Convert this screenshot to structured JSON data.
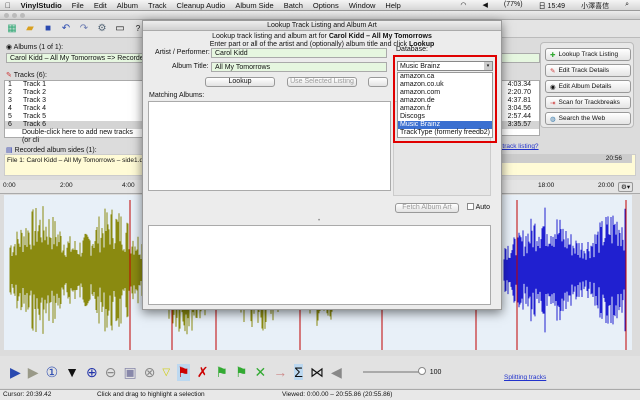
{
  "menubar": {
    "app": "VinylStudio",
    "items": [
      "File",
      "Edit",
      "Album",
      "Track",
      "Cleanup Audio",
      "Album Side",
      "Batch",
      "Options",
      "Window",
      "Help"
    ],
    "battery": "(77%)",
    "clock": "日 15:49",
    "user": "小澤喜信"
  },
  "albums": {
    "label": "Albums (1 of 1):",
    "value": "Carol Kidd – All My Tomorrows => Recorded"
  },
  "tracks": {
    "label": "Tracks (6):",
    "rows": [
      {
        "n": "1",
        "name": "Track 1",
        "time": "4:03.34"
      },
      {
        "n": "2",
        "name": "Track 2",
        "time": "2:20.70"
      },
      {
        "n": "3",
        "name": "Track 3",
        "time": "4:37.81"
      },
      {
        "n": "4",
        "name": "Track 4",
        "time": "3:04.56"
      },
      {
        "n": "5",
        "name": "Track 5",
        "time": "2:57.44"
      },
      {
        "n": "6",
        "name": "Track 6",
        "time": "3:35.57"
      }
    ],
    "hint": "Double-click here to add new tracks (or cli"
  },
  "right_buttons": [
    "Lookup Track Listing",
    "Edit Track Details",
    "Edit Album Details",
    "Scan for Trackbreaks",
    "Search the Web"
  ],
  "track_listing_link": "e track listing?",
  "sides": {
    "label": "Recorded album sides (1):",
    "file": "File 1: Carol Kidd – All My Tomorrows – side1.d",
    "duration": "20:56"
  },
  "ruler": [
    "0:00",
    "2:00",
    "4:00",
    "18:00",
    "20:00"
  ],
  "dialog": {
    "title": "Lookup Track Listing and Album Art",
    "intro1": "Lookup track listing and album art for ",
    "intro1b": "Carol Kidd – All My Tomorrows",
    "intro2": "Enter part or all of the artist and (optionally) album title and click ",
    "intro2b": "Lookup",
    "artist_label": "Artist / Performer:",
    "artist": "Carol Kidd",
    "album_label": "Album Title:",
    "album": "All My Tomorrows",
    "lookup": "Lookup",
    "use_selected": "Use Selected Listing",
    "matching": "Matching Albums:",
    "database_label": "Database:",
    "database": "Music Brainz",
    "options": [
      "amazon.ca",
      "amazon.co.uk",
      "amazon.com",
      "amazon.de",
      "amazon.fr",
      "Discogs",
      "Music Brainz",
      "TrackType (formerly freedb2)"
    ],
    "fetch_art": "Fetch Album Art",
    "auto": "Auto"
  },
  "volume": "100",
  "splitting_link": "Splitting tracks",
  "status": {
    "cursor": "Cursor: 20:39.42",
    "hint": "Click and drag to highlight a selection",
    "viewed": "Viewed: 0:00.00 – 20:55.86 (20:55.86)"
  },
  "colors": {
    "wave_left": "#8a8a10",
    "wave_right": "#2020d0",
    "marker": "#c00000",
    "highlight": "#e00000"
  }
}
